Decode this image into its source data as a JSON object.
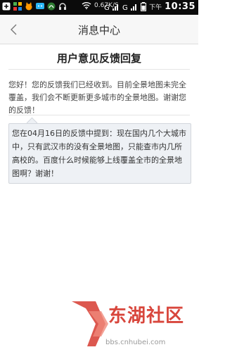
{
  "status_bar": {
    "speed": "0.67K/S",
    "time_prefix": "下午",
    "time": "10:35"
  },
  "header": {
    "title": "消息中心"
  },
  "message": {
    "subject": "用户意见反馈回复",
    "reply": "您好！您的反馈我们已经收到。目前全景地图未完全覆盖，我们会不断更新更多城市的全景地图。谢谢您的反馈！",
    "feedback": "您在04月16日的反馈中提到：现在国内几个大城市中，只有武汉市的没有全景地图，只能查市内几所高校的。百度什么时候能够上线覆盖全市的全景地图啊？谢谢！"
  },
  "watermark": {
    "name": "东湖社区",
    "url": "bbs.cnhubei.com"
  },
  "colors": {
    "statusbar": "#0b0b0b",
    "header_bg": "#f7f7f7",
    "bubble_bg": "#eef1f5",
    "watermark_red": "#d8463c"
  }
}
